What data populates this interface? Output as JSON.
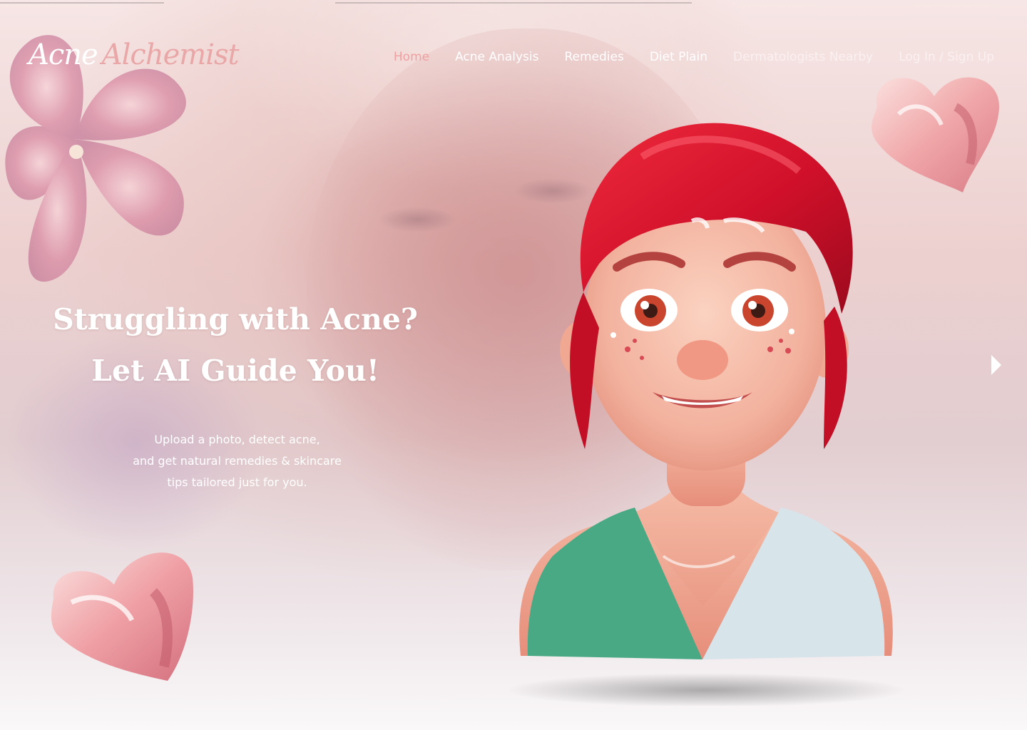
{
  "brand": {
    "part1": "Acne",
    "part2": "Alchemist"
  },
  "nav": {
    "items": [
      {
        "label": "Home",
        "state": "active"
      },
      {
        "label": "Acne Analysis",
        "state": "normal"
      },
      {
        "label": "Remedies",
        "state": "normal"
      },
      {
        "label": "Diet Plain",
        "state": "normal"
      },
      {
        "label": "Dermatologists Nearby",
        "state": "faded"
      },
      {
        "label": "Log In / Sign Up",
        "state": "faded"
      }
    ]
  },
  "hero": {
    "title_line1": "Struggling with Acne?",
    "title_line2": "Let AI Guide You!",
    "sub_line1": "Upload a photo, detect acne,",
    "sub_line2": "and get natural remedies & skincare",
    "sub_line3": "tips tailored just for you."
  },
  "icons": {
    "next": "chevron-right-icon",
    "hearts": "heart-icon"
  },
  "colors": {
    "accent": "#f0a0a0",
    "brand_secondary": "#e9a7a7",
    "hair": "#d8122c",
    "shirt_green": "#4aa985",
    "shirt_light": "#d7e4ea",
    "skin": "#f6c2ad"
  }
}
